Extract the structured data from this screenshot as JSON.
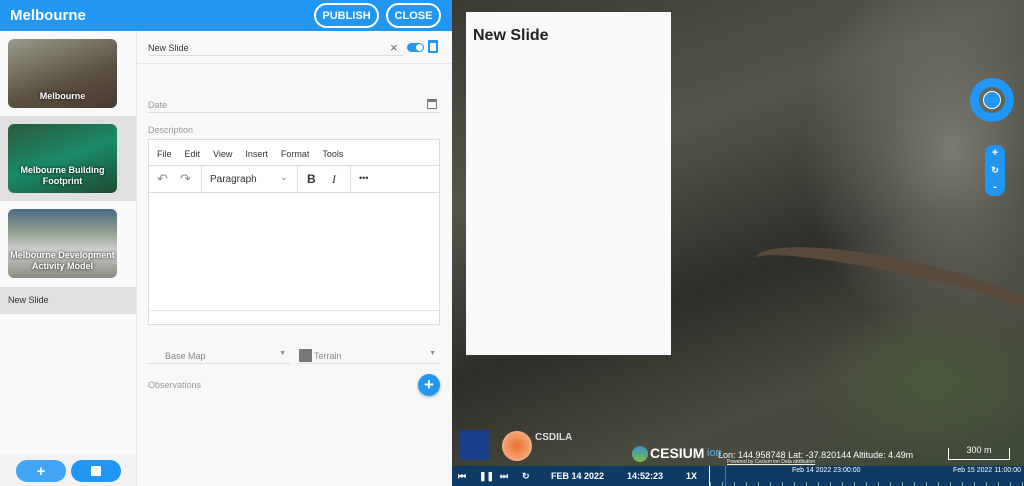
{
  "header": {
    "title": "Melbourne",
    "publish": "PUBLISH",
    "close": "CLOSE"
  },
  "sidebar": {
    "slides": [
      {
        "label": "Melbourne"
      },
      {
        "label": "Melbourne Building Footprint"
      },
      {
        "label": "Melbourne Development Activity Model"
      }
    ],
    "new_slide": "New Slide"
  },
  "editor": {
    "title_value": "New Slide",
    "date_label": "Date",
    "description_label": "Description",
    "menu": [
      "File",
      "Edit",
      "View",
      "Insert",
      "Format",
      "Tools"
    ],
    "block_format": "Paragraph",
    "bold": "B",
    "italic": "I",
    "more": "•••",
    "base_map": "Base Map",
    "terrain": "Terrain",
    "observations": "Observations"
  },
  "map": {
    "card_title": "New Slide",
    "coords": "Lon: 144.958748 Lat: -37.820144 Altitude: 4.49m",
    "scale": "300 m",
    "cesium": "CESIUM",
    "ion": "ion",
    "credits": "Powered by Cesium ion   Data attribution",
    "logo_text": "CSDILA"
  },
  "timeline": {
    "date": "FEB 14 2022",
    "time": "14:52:23",
    "speed": "1X",
    "label1": "Feb 14 2022 23:00:00",
    "label2": "Feb 15 2022 11:00:00"
  },
  "colors": {
    "accent": "#2196f3",
    "timeline": "#0d3b66"
  }
}
